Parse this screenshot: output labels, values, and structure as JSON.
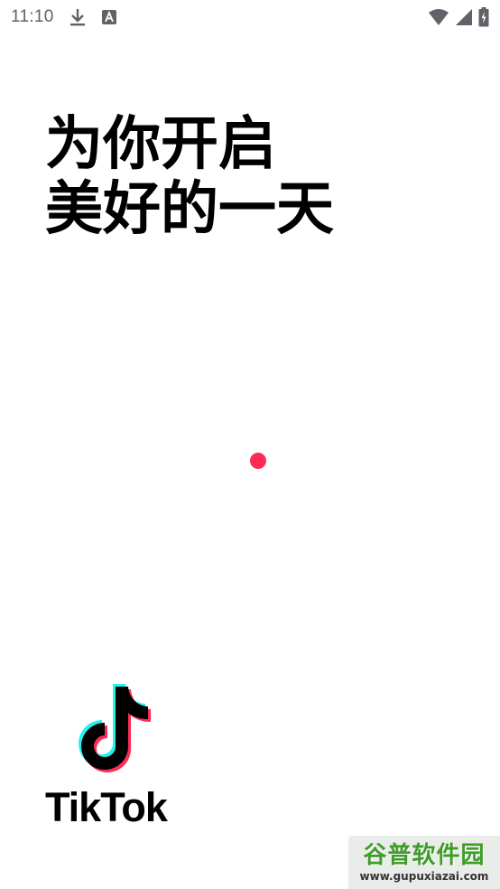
{
  "status_bar": {
    "time": "11:10",
    "icons": [
      "download-icon",
      "keyboard-a-icon",
      "wifi-icon",
      "signal-icon",
      "battery-charging-icon"
    ]
  },
  "headline": {
    "line1": "为你开启",
    "line2": "美好的一天"
  },
  "loading": {
    "color": "#fe2c55"
  },
  "logo": {
    "wordmark": "TikTok",
    "colors": {
      "cyan": "#25f4ee",
      "red": "#fe2c55",
      "black": "#000000"
    }
  },
  "watermark": {
    "title": "谷普软件园",
    "url": "www.gupuxiazai.com"
  }
}
